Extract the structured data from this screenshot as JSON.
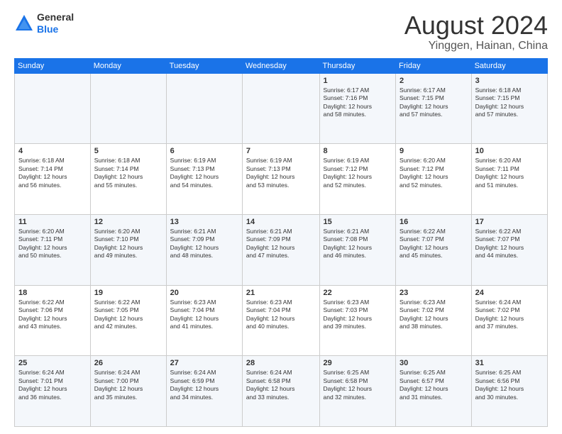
{
  "header": {
    "logo_general": "General",
    "logo_blue": "Blue",
    "month": "August 2024",
    "location": "Yinggen, Hainan, China"
  },
  "days_of_week": [
    "Sunday",
    "Monday",
    "Tuesday",
    "Wednesday",
    "Thursday",
    "Friday",
    "Saturday"
  ],
  "weeks": [
    [
      {
        "day": "",
        "info": ""
      },
      {
        "day": "",
        "info": ""
      },
      {
        "day": "",
        "info": ""
      },
      {
        "day": "",
        "info": ""
      },
      {
        "day": "1",
        "info": "Sunrise: 6:17 AM\nSunset: 7:16 PM\nDaylight: 12 hours\nand 58 minutes."
      },
      {
        "day": "2",
        "info": "Sunrise: 6:17 AM\nSunset: 7:15 PM\nDaylight: 12 hours\nand 57 minutes."
      },
      {
        "day": "3",
        "info": "Sunrise: 6:18 AM\nSunset: 7:15 PM\nDaylight: 12 hours\nand 57 minutes."
      }
    ],
    [
      {
        "day": "4",
        "info": "Sunrise: 6:18 AM\nSunset: 7:14 PM\nDaylight: 12 hours\nand 56 minutes."
      },
      {
        "day": "5",
        "info": "Sunrise: 6:18 AM\nSunset: 7:14 PM\nDaylight: 12 hours\nand 55 minutes."
      },
      {
        "day": "6",
        "info": "Sunrise: 6:19 AM\nSunset: 7:13 PM\nDaylight: 12 hours\nand 54 minutes."
      },
      {
        "day": "7",
        "info": "Sunrise: 6:19 AM\nSunset: 7:13 PM\nDaylight: 12 hours\nand 53 minutes."
      },
      {
        "day": "8",
        "info": "Sunrise: 6:19 AM\nSunset: 7:12 PM\nDaylight: 12 hours\nand 52 minutes."
      },
      {
        "day": "9",
        "info": "Sunrise: 6:20 AM\nSunset: 7:12 PM\nDaylight: 12 hours\nand 52 minutes."
      },
      {
        "day": "10",
        "info": "Sunrise: 6:20 AM\nSunset: 7:11 PM\nDaylight: 12 hours\nand 51 minutes."
      }
    ],
    [
      {
        "day": "11",
        "info": "Sunrise: 6:20 AM\nSunset: 7:11 PM\nDaylight: 12 hours\nand 50 minutes."
      },
      {
        "day": "12",
        "info": "Sunrise: 6:20 AM\nSunset: 7:10 PM\nDaylight: 12 hours\nand 49 minutes."
      },
      {
        "day": "13",
        "info": "Sunrise: 6:21 AM\nSunset: 7:09 PM\nDaylight: 12 hours\nand 48 minutes."
      },
      {
        "day": "14",
        "info": "Sunrise: 6:21 AM\nSunset: 7:09 PM\nDaylight: 12 hours\nand 47 minutes."
      },
      {
        "day": "15",
        "info": "Sunrise: 6:21 AM\nSunset: 7:08 PM\nDaylight: 12 hours\nand 46 minutes."
      },
      {
        "day": "16",
        "info": "Sunrise: 6:22 AM\nSunset: 7:07 PM\nDaylight: 12 hours\nand 45 minutes."
      },
      {
        "day": "17",
        "info": "Sunrise: 6:22 AM\nSunset: 7:07 PM\nDaylight: 12 hours\nand 44 minutes."
      }
    ],
    [
      {
        "day": "18",
        "info": "Sunrise: 6:22 AM\nSunset: 7:06 PM\nDaylight: 12 hours\nand 43 minutes."
      },
      {
        "day": "19",
        "info": "Sunrise: 6:22 AM\nSunset: 7:05 PM\nDaylight: 12 hours\nand 42 minutes."
      },
      {
        "day": "20",
        "info": "Sunrise: 6:23 AM\nSunset: 7:04 PM\nDaylight: 12 hours\nand 41 minutes."
      },
      {
        "day": "21",
        "info": "Sunrise: 6:23 AM\nSunset: 7:04 PM\nDaylight: 12 hours\nand 40 minutes."
      },
      {
        "day": "22",
        "info": "Sunrise: 6:23 AM\nSunset: 7:03 PM\nDaylight: 12 hours\nand 39 minutes."
      },
      {
        "day": "23",
        "info": "Sunrise: 6:23 AM\nSunset: 7:02 PM\nDaylight: 12 hours\nand 38 minutes."
      },
      {
        "day": "24",
        "info": "Sunrise: 6:24 AM\nSunset: 7:02 PM\nDaylight: 12 hours\nand 37 minutes."
      }
    ],
    [
      {
        "day": "25",
        "info": "Sunrise: 6:24 AM\nSunset: 7:01 PM\nDaylight: 12 hours\nand 36 minutes."
      },
      {
        "day": "26",
        "info": "Sunrise: 6:24 AM\nSunset: 7:00 PM\nDaylight: 12 hours\nand 35 minutes."
      },
      {
        "day": "27",
        "info": "Sunrise: 6:24 AM\nSunset: 6:59 PM\nDaylight: 12 hours\nand 34 minutes."
      },
      {
        "day": "28",
        "info": "Sunrise: 6:24 AM\nSunset: 6:58 PM\nDaylight: 12 hours\nand 33 minutes."
      },
      {
        "day": "29",
        "info": "Sunrise: 6:25 AM\nSunset: 6:58 PM\nDaylight: 12 hours\nand 32 minutes."
      },
      {
        "day": "30",
        "info": "Sunrise: 6:25 AM\nSunset: 6:57 PM\nDaylight: 12 hours\nand 31 minutes."
      },
      {
        "day": "31",
        "info": "Sunrise: 6:25 AM\nSunset: 6:56 PM\nDaylight: 12 hours\nand 30 minutes."
      }
    ]
  ]
}
